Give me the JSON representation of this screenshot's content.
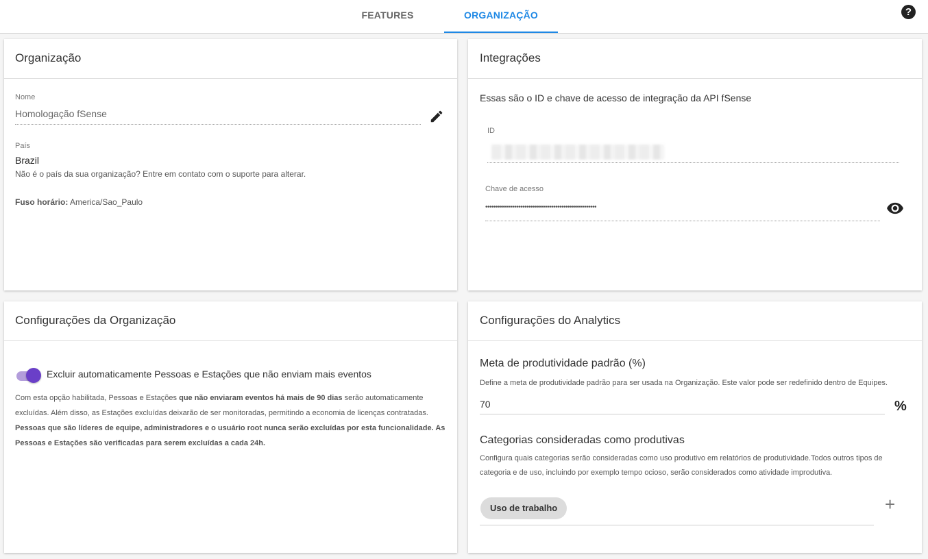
{
  "tabs": [
    {
      "label": "FEATURES"
    },
    {
      "label": "ORGANIZAÇÃO"
    }
  ],
  "help_icon": "question-circle-icon",
  "organizacao": {
    "title": "Organização",
    "nome_label": "Nome",
    "nome_value": "Homologação fSense",
    "pais_label": "País",
    "pais_value": "Brazil",
    "pais_hint": "Não é o país da sua organização? Entre em contato com o suporte para alterar.",
    "fuso_label": "Fuso horário:",
    "fuso_value": "America/Sao_Paulo"
  },
  "integracoes": {
    "title": "Integrações",
    "description": "Essas são o ID e chave de acesso de integração da API fSense",
    "id_label": "ID",
    "chave_label": "Chave de acesso",
    "chave_value": "••••••••••••••••••••••••••••••••••••••••••••••••••••••"
  },
  "config_org": {
    "title": "Configurações da Organização",
    "toggle_label": "Excluir automaticamente Pessoas e Estações que não enviam mais eventos",
    "toggle_on": true,
    "desc_1": "Com esta opção habilitada, Pessoas e Estações ",
    "desc_1_bold": "que não enviaram eventos há mais de 90 dias",
    "desc_2": " serão automaticamente excluídas. Além disso, as Estações excluídas deixarão de ser monitoradas, permitindo a economia de licenças contratadas. ",
    "desc_3_bold": "Pessoas que são líderes de equipe, administradores e o usuário root nunca serão excluídas por esta funcionalidade. As Pessoas e Estações são verificadas para serem excluídas a cada 24h."
  },
  "analytics": {
    "title": "Configurações do Analytics",
    "meta_title": "Meta de produtividade padrão (%)",
    "meta_desc": "Define a meta de produtividade padrão para ser usada na Organização. Este valor pode ser redefinido dentro de Equipes.",
    "meta_value": "70",
    "percent_symbol": "%",
    "categorias_title": "Categorias consideradas como produtivas",
    "categorias_desc": "Configura quais categorias serão consideradas como uso produtivo em relatórios de produtividade.Todos outros tipos de categoria e de uso, incluindo por exemplo tempo ocioso, serão considerados como atividade improdutiva.",
    "chips": [
      "Uso de trabalho"
    ],
    "add_symbol": "+"
  },
  "colors": {
    "accent": "#1e88e5",
    "toggle": "#6a3fc8"
  }
}
